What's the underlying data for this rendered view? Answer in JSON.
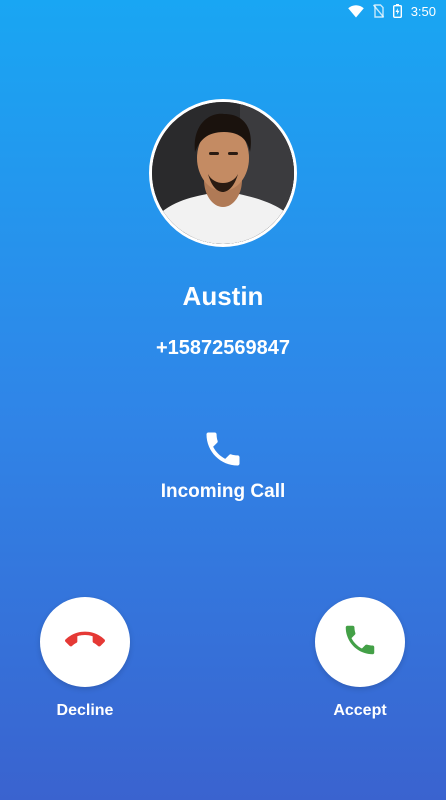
{
  "status_bar": {
    "time": "3:50",
    "icons": [
      "wifi-icon",
      "no-sim-icon",
      "battery-icon"
    ]
  },
  "caller": {
    "name": "Austin",
    "number": "+15872569847",
    "avatar": "caller-photo"
  },
  "call_state": {
    "label": "Incoming Call",
    "icon": "phone-icon"
  },
  "actions": {
    "decline_label": "Decline",
    "accept_label": "Accept",
    "decline_icon": "hang-up-icon",
    "accept_icon": "phone-icon"
  },
  "colors": {
    "gradient_top": "#19a6f3",
    "gradient_bottom": "#3a63cf",
    "decline": "#e53935",
    "accept": "#43a047"
  }
}
